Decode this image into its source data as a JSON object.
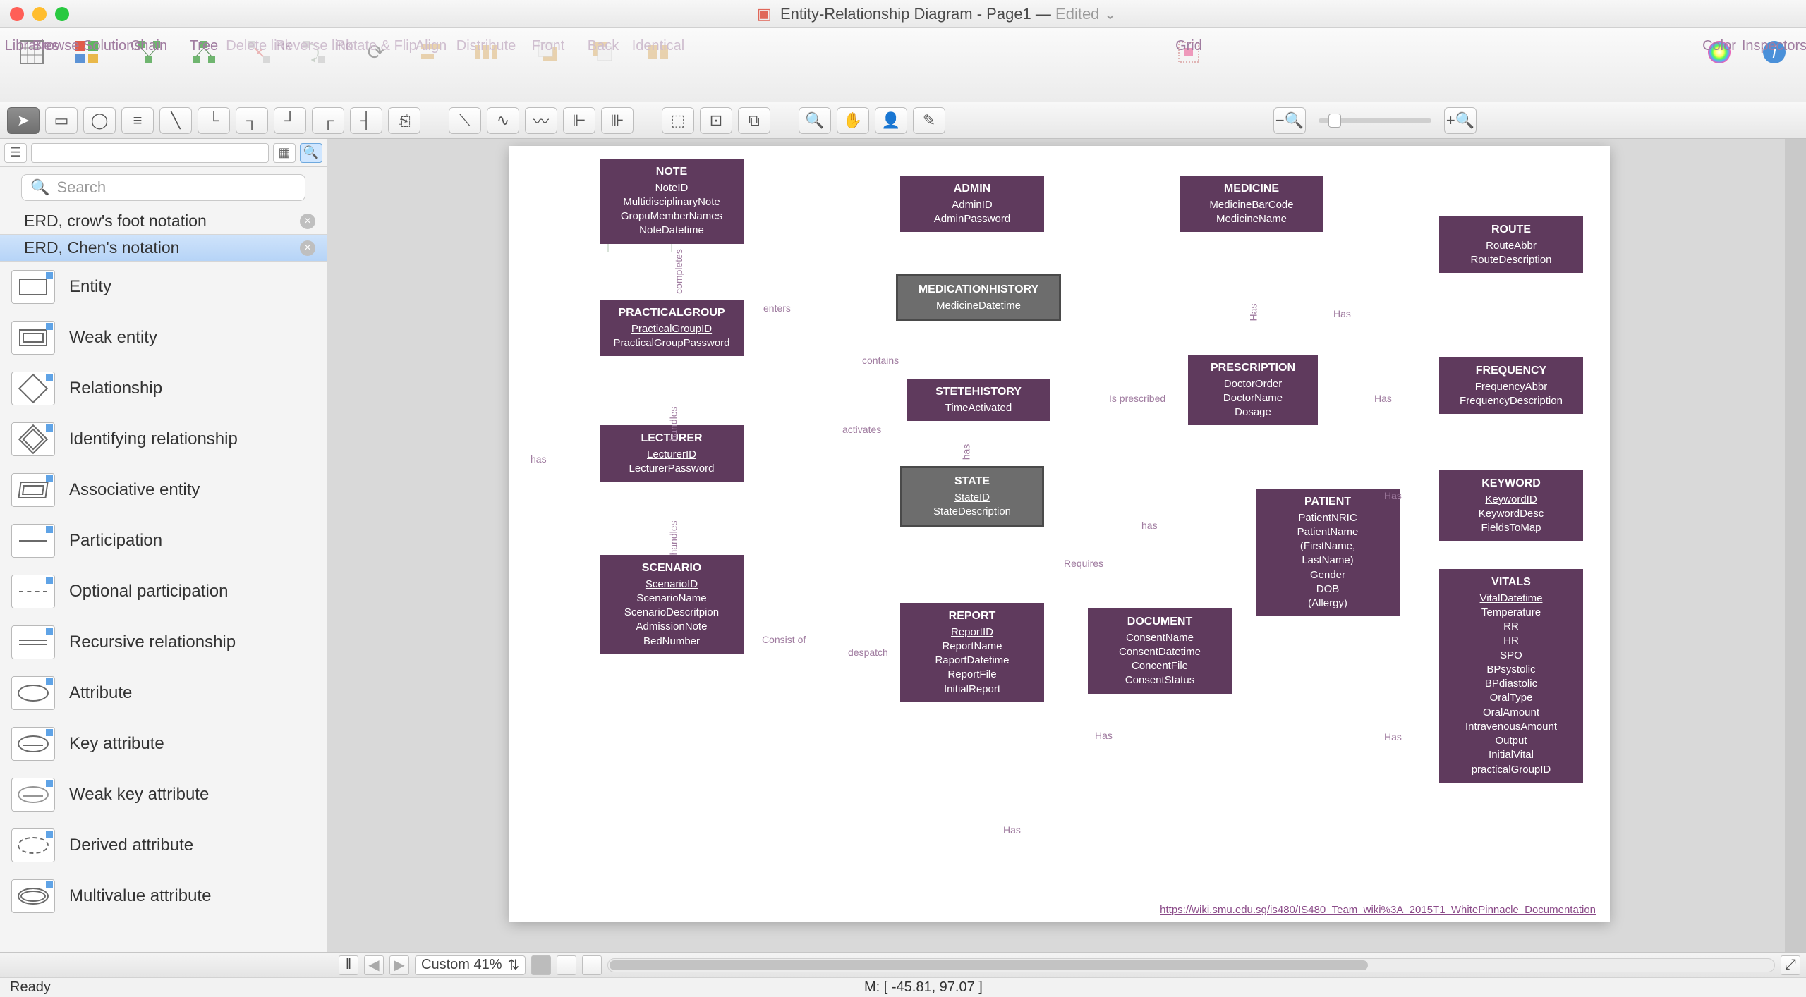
{
  "window": {
    "title_doc": "Entity-Relationship Diagram",
    "title_page": "Page1",
    "title_state": "Edited"
  },
  "toolbar": {
    "libraries": "Libraries",
    "browse": "Browse Solutions",
    "chain": "Chain",
    "tree": "Tree",
    "delete_link": "Delete link",
    "reverse_link": "Reverse link",
    "rotate_flip": "Rotate & Flip",
    "align": "Align",
    "distribute": "Distribute",
    "front": "Front",
    "back": "Back",
    "identical": "Identical",
    "grid": "Grid",
    "color": "Color",
    "inspectors": "Inspectors"
  },
  "sidebar": {
    "search_placeholder": "Search",
    "notations": [
      {
        "label": "ERD, crow's foot notation",
        "selected": false
      },
      {
        "label": "ERD, Chen's notation",
        "selected": true
      }
    ],
    "shapes": [
      "Entity",
      "Weak entity",
      "Relationship",
      "Identifying relationship",
      "Associative entity",
      "Participation",
      "Optional participation",
      "Recursive relationship",
      "Attribute",
      "Key attribute",
      "Weak key attribute",
      "Derived attribute",
      "Multivalue attribute"
    ]
  },
  "canvas": {
    "footer_link": "https://wiki.smu.edu.sg/is480/IS480_Team_wiki%3A_2015T1_WhitePinnacle_Documentation",
    "entities": {
      "note": {
        "title": "NOTE",
        "attrs": [
          "NoteID",
          "MultidisciplinaryNote",
          "GropuMemberNames",
          "NoteDatetime"
        ]
      },
      "admin": {
        "title": "ADMIN",
        "attrs": [
          "AdminID",
          "AdminPassword"
        ]
      },
      "medicine": {
        "title": "MEDICINE",
        "attrs": [
          "MedicineBarCode",
          "MedicineName"
        ]
      },
      "route": {
        "title": "ROUTE",
        "attrs": [
          "RouteAbbr",
          "RouteDescription"
        ]
      },
      "medhist": {
        "title": "MEDICATIONHISTORY",
        "attrs": [
          "MedicineDatetime"
        ]
      },
      "practical": {
        "title": "PRACTICALGROUP",
        "attrs": [
          "PracticalGroupID",
          "PracticalGroupPassword"
        ]
      },
      "statehist": {
        "title": "STETEHISTORY",
        "attrs": [
          "TimeActivated"
        ]
      },
      "prescription": {
        "title": "PRESCRIPTION",
        "attrs": [
          "DoctorOrder",
          "DoctorName",
          "Dosage"
        ]
      },
      "frequency": {
        "title": "FREQUENCY",
        "attrs": [
          "FrequencyAbbr",
          "FrequencyDescription"
        ]
      },
      "lecturer": {
        "title": "LECTURER",
        "attrs": [
          "LecturerID",
          "LecturerPassword"
        ]
      },
      "state": {
        "title": "STATE",
        "attrs": [
          "StateID",
          "StateDescription"
        ]
      },
      "keyword": {
        "title": "KEYWORD",
        "attrs": [
          "KeywordID",
          "KeywordDesc",
          "FieldsToMap"
        ]
      },
      "scenario": {
        "title": "SCENARIO",
        "attrs": [
          "ScenarioID",
          "ScenarioName",
          "ScenarioDescritpion",
          "AdmissionNote",
          "BedNumber"
        ]
      },
      "patient": {
        "title": "PATIENT",
        "attrs": [
          "PatientNRIC",
          "PatientName",
          "(FirstName,",
          "LastName)",
          "Gender",
          "DOB",
          "(Allergy)"
        ]
      },
      "report": {
        "title": "REPORT",
        "attrs": [
          "ReportID",
          "ReportName",
          "RaportDatetime",
          "ReportFile",
          "InitialReport"
        ]
      },
      "document": {
        "title": "DOCUMENT",
        "attrs": [
          "ConsentName",
          "ConsentDatetime",
          "ConcentFile",
          "ConsentStatus"
        ]
      },
      "vitals": {
        "title": "VITALS",
        "attrs": [
          "VitalDatetime",
          "Temperature",
          "RR",
          "HR",
          "SPO",
          "BPsystolic",
          "BPdiastolic",
          "OralType",
          "OralAmount",
          "IntravenousAmount",
          "Output",
          "InitialVital",
          "practicalGroupID"
        ]
      }
    },
    "labels": {
      "completes": "completes",
      "enters": "enters",
      "has_left": "has",
      "handles1": "handles",
      "handles2": "handles",
      "contains": "contains",
      "activates": "activates",
      "has_state": "has",
      "is_prescribed": "Is prescribed",
      "has_med": "Has",
      "has_route": "Has",
      "has_freq": "Has",
      "has_pt": "has",
      "requires": "Requires",
      "consist": "Consist of",
      "despatch": "despatch",
      "has_doc": "Has",
      "has_vitals": "Has",
      "has_kw": "Has",
      "has_bottom": "Has"
    }
  },
  "footer": {
    "zoom": "Custom 41%"
  },
  "status": {
    "ready": "Ready",
    "mouse": "M: [ -45.81, 97.07 ]"
  }
}
